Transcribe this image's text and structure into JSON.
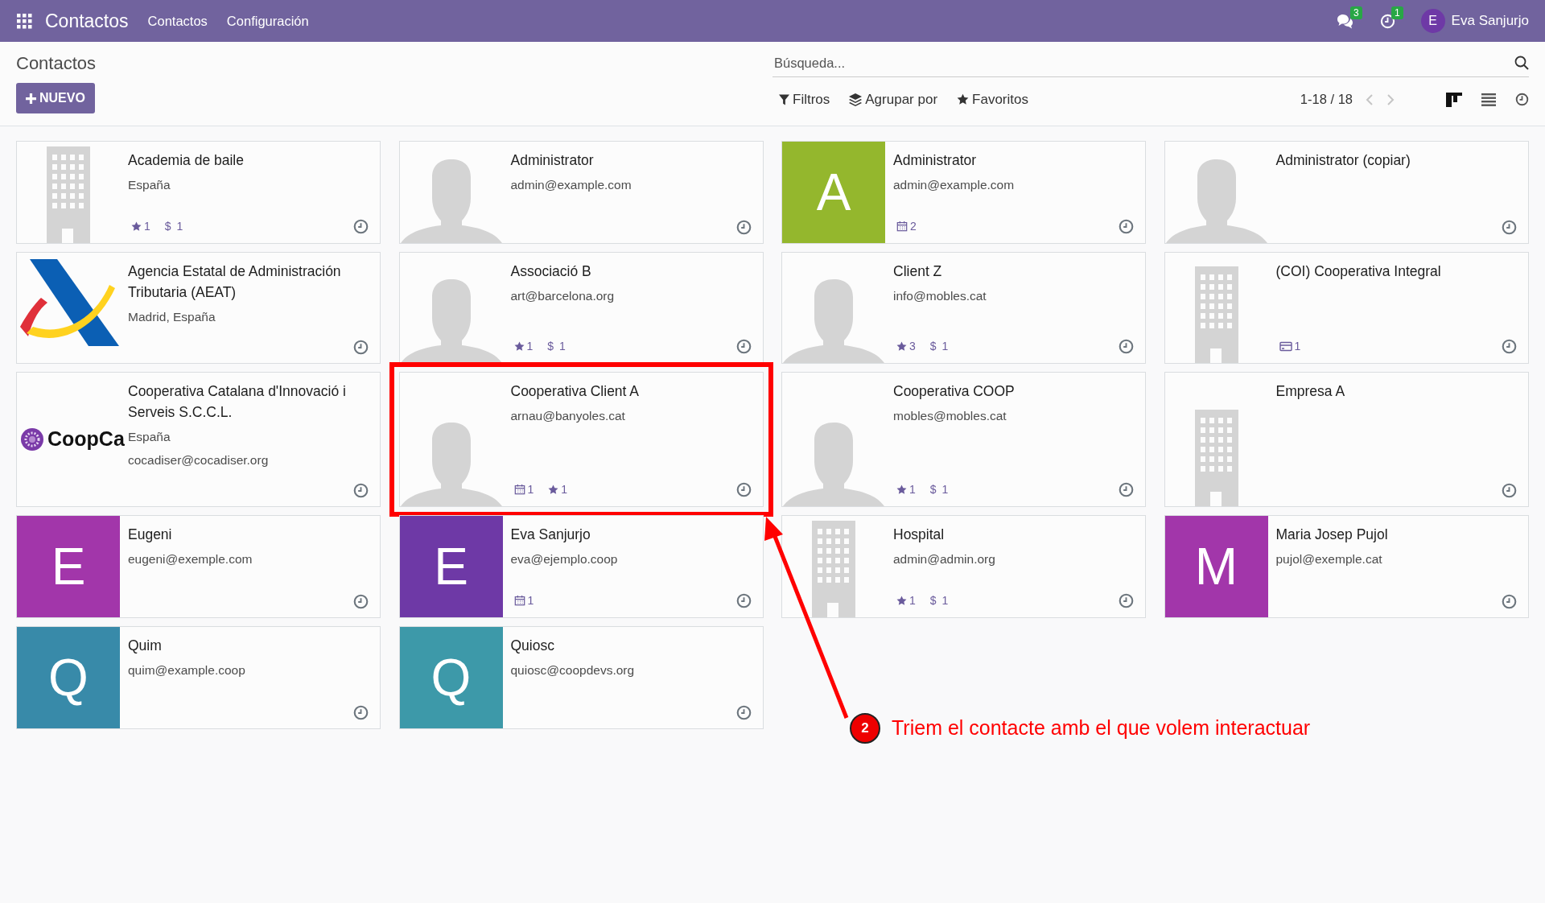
{
  "navbar": {
    "app_title": "Contactos",
    "menu": [
      "Contactos",
      "Configuración"
    ],
    "messages_count": "3",
    "activities_count": "1",
    "user_initial": "E",
    "user_name": "Eva Sanjurjo"
  },
  "breadcrumb": "Contactos",
  "new_button": "NUEVO",
  "search": {
    "placeholder": "Búsqueda..."
  },
  "filters": [
    {
      "kind": "filter",
      "label": "Filtros"
    },
    {
      "kind": "group",
      "label": "Agrupar por"
    },
    {
      "kind": "favorite",
      "label": "Favoritos"
    }
  ],
  "pager": "1-18 / 18",
  "views": [
    {
      "kind": "kanban",
      "selected": true
    },
    {
      "kind": "list",
      "selected": false
    },
    {
      "kind": "activity",
      "selected": false
    }
  ],
  "cards": [
    {
      "name": "Academia de baile",
      "lines": [
        "España"
      ],
      "image": {
        "kind": "building"
      },
      "badges": [
        {
          "kind": "star",
          "count": "1"
        },
        {
          "kind": "dollar",
          "icon": "$",
          "count": "1"
        }
      ],
      "highlighted": false
    },
    {
      "name": "Administrator",
      "lines": [
        "admin@example.com"
      ],
      "image": {
        "kind": "person"
      },
      "highlighted": false
    },
    {
      "name": "Administrator",
      "lines": [
        "admin@example.com"
      ],
      "image": {
        "kind": "initial",
        "letter": "A",
        "color": "#94b72d"
      },
      "badges": [
        {
          "kind": "calendar",
          "count": "2"
        }
      ],
      "highlighted": false
    },
    {
      "name": "Administrator (copiar)",
      "image": {
        "kind": "person"
      },
      "highlighted": false
    },
    {
      "name": "Agencia Estatal de Administración Tributaria (AEAT)",
      "lines": [
        "Madrid, España"
      ],
      "image": {
        "kind": "aeat-logo"
      },
      "highlighted": false
    },
    {
      "name": "Associació B",
      "lines": [
        "art@barcelona.org"
      ],
      "image": {
        "kind": "person"
      },
      "badges": [
        {
          "kind": "star",
          "count": "1"
        },
        {
          "kind": "dollar",
          "icon": "$",
          "count": "1"
        }
      ],
      "highlighted": false
    },
    {
      "name": "Client Z",
      "lines": [
        "info@mobles.cat"
      ],
      "image": {
        "kind": "person"
      },
      "badges": [
        {
          "kind": "star",
          "count": "3"
        },
        {
          "kind": "dollar",
          "icon": "$",
          "count": "1"
        }
      ],
      "highlighted": false
    },
    {
      "name": "(COI) Cooperativa Integral",
      "image": {
        "kind": "building"
      },
      "badges": [
        {
          "kind": "card",
          "count": "1"
        }
      ],
      "highlighted": false
    },
    {
      "name": "Cooperativa Catalana d'Innovació i Serveis S.C.C.L.",
      "lines": [
        "España",
        "cocadiser@cocadiser.org"
      ],
      "image": {
        "kind": "coopca-logo",
        "text": "CoopCa"
      },
      "highlighted": false
    },
    {
      "name": "Cooperativa Client A",
      "lines": [
        "arnau@banyoles.cat"
      ],
      "image": {
        "kind": "person"
      },
      "badges": [
        {
          "kind": "calendar",
          "count": "1"
        },
        {
          "kind": "star",
          "count": "1"
        }
      ],
      "highlighted": true
    },
    {
      "name": "Cooperativa COOP",
      "lines": [
        "mobles@mobles.cat"
      ],
      "image": {
        "kind": "person"
      },
      "badges": [
        {
          "kind": "star",
          "count": "1"
        },
        {
          "kind": "dollar",
          "icon": "$",
          "count": "1"
        }
      ],
      "highlighted": false
    },
    {
      "name": "Empresa A",
      "image": {
        "kind": "building"
      },
      "highlighted": false
    },
    {
      "name": "Eugeni",
      "lines": [
        "eugeni@exemple.com"
      ],
      "image": {
        "kind": "initial",
        "letter": "E",
        "color": "#a236aa"
      },
      "highlighted": false
    },
    {
      "name": "Eva Sanjurjo",
      "lines": [
        "eva@ejemplo.coop"
      ],
      "image": {
        "kind": "initial",
        "letter": "E",
        "color": "#6e39a6"
      },
      "badges": [
        {
          "kind": "calendar",
          "count": "1"
        }
      ],
      "highlighted": false
    },
    {
      "name": "Hospital",
      "lines": [
        "admin@admin.org"
      ],
      "image": {
        "kind": "building"
      },
      "badges": [
        {
          "kind": "star",
          "count": "1"
        },
        {
          "kind": "dollar",
          "icon": "$",
          "count": "1"
        }
      ],
      "highlighted": false
    },
    {
      "name": "Maria Josep Pujol",
      "lines": [
        "pujol@exemple.cat"
      ],
      "image": {
        "kind": "initial",
        "letter": "M",
        "color": "#a236aa"
      },
      "highlighted": false
    },
    {
      "name": "Quim",
      "lines": [
        "quim@example.coop"
      ],
      "image": {
        "kind": "initial",
        "letter": "Q",
        "color": "#388aa9"
      },
      "highlighted": false
    },
    {
      "name": "Quiosc",
      "lines": [
        "quiosc@coopdevs.org"
      ],
      "image": {
        "kind": "initial",
        "letter": "Q",
        "color": "#3d99a9"
      },
      "highlighted": false
    }
  ],
  "annotation": {
    "step": "2",
    "text": "Triem el contacte amb el que volem interactuar"
  }
}
